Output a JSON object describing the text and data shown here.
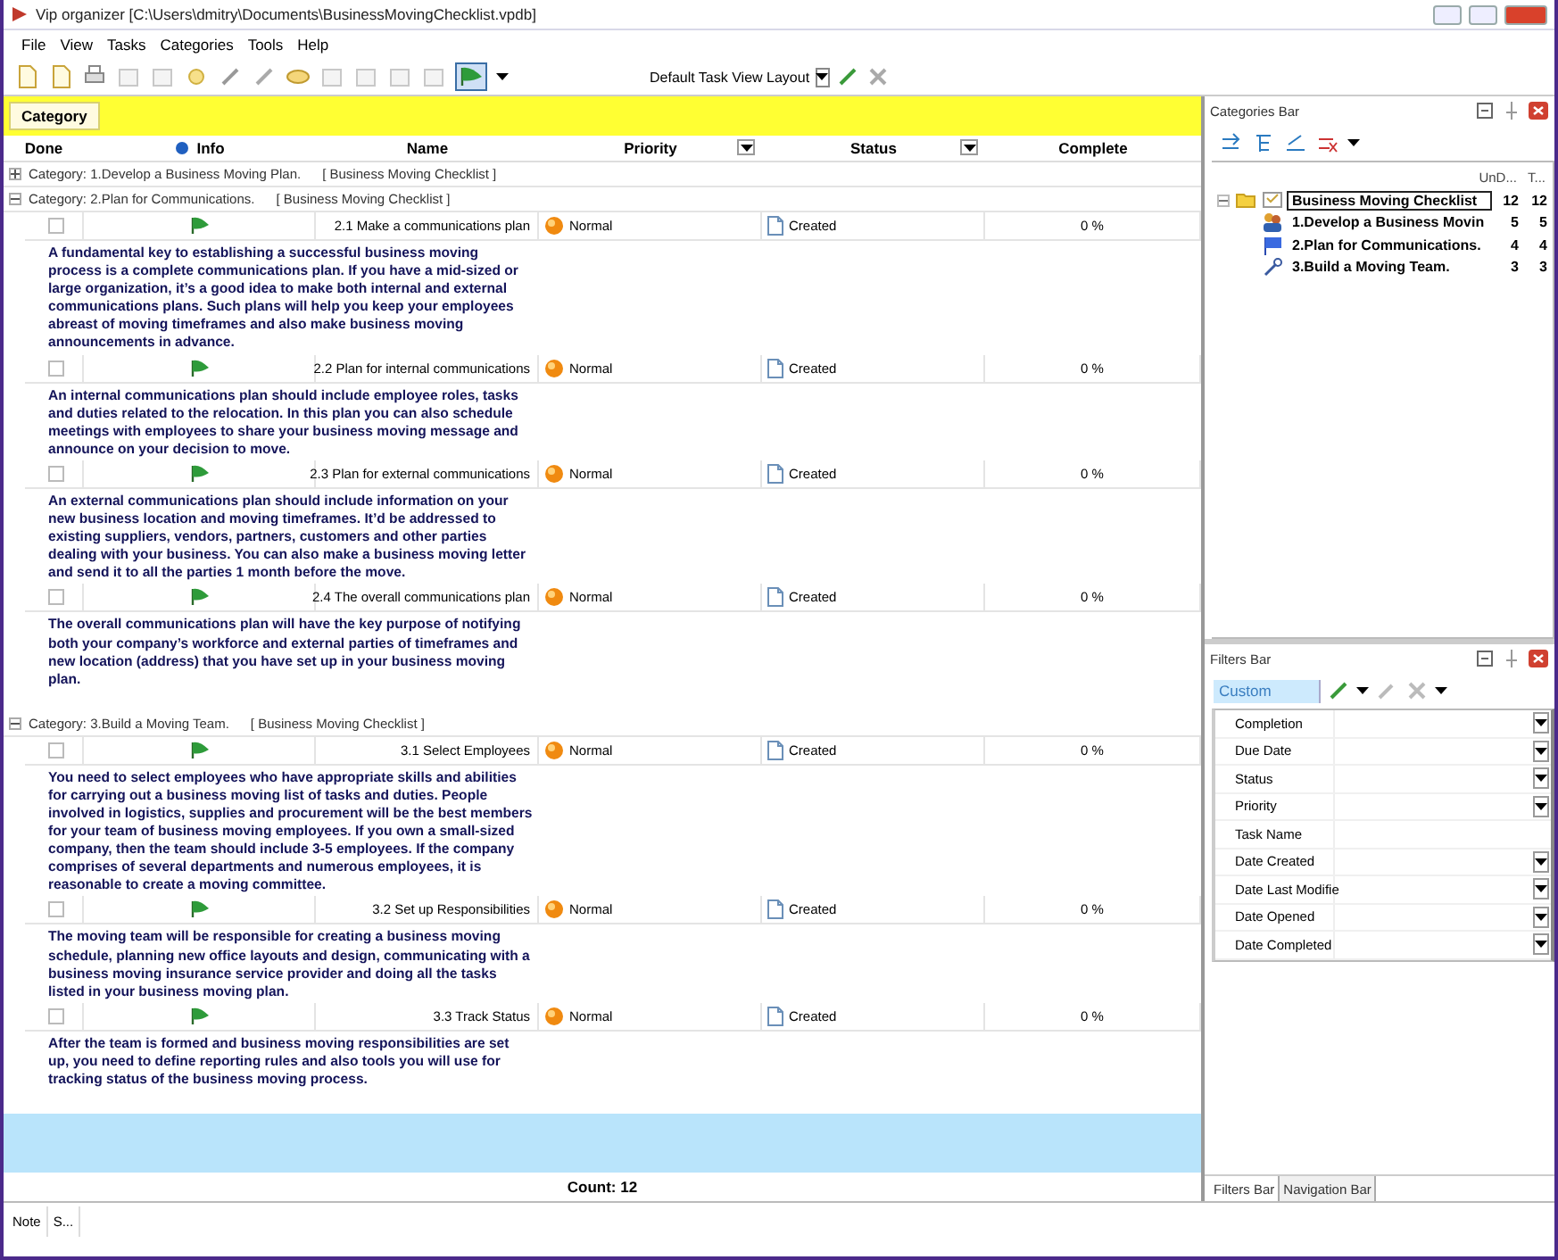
{
  "window": {
    "title": "Vip organizer [C:\\Users\\dmitry\\Documents\\BusinessMovingChecklist.vpdb]"
  },
  "menu": [
    "File",
    "View",
    "Tasks",
    "Categories",
    "Tools",
    "Help"
  ],
  "toolbar": {
    "layout": "Default Task View Layout"
  },
  "group_by": {
    "label": "Category"
  },
  "columns": [
    "Done",
    "Info",
    "Name",
    "Priority",
    "Status",
    "Complete"
  ],
  "groups": [
    {
      "label": "Category: 1.Develop a Business Moving Plan.",
      "checklist": "[ Business Moving Checklist ]",
      "expanded": false
    },
    {
      "label": "Category: 2.Plan for Communications.",
      "checklist": "[ Business Moving Checklist ]",
      "expanded": true,
      "tasks": [
        {
          "done": false,
          "name": "2.1 Make a communications plan",
          "priority": "Normal",
          "status": "Created",
          "complete": "0 %",
          "description": "A fundamental key to establishing a successful business moving process is a complete communications plan. If you have a mid-sized or large organization, it’s a good idea to make both internal and external communications plans. Such plans will help you keep your employees abreast of moving timeframes and also make business moving announcements in advance."
        },
        {
          "done": false,
          "name": "2.2 Plan for internal communications",
          "priority": "Normal",
          "status": "Created",
          "complete": "0 %",
          "description": "An internal communications plan should include employee roles, tasks and duties related to the relocation. In this plan you can also schedule meetings with employees to share your business moving message and announce on your decision to move."
        },
        {
          "done": false,
          "name": "2.3 Plan for external communications",
          "priority": "Normal",
          "status": "Created",
          "complete": "0 %",
          "description": "An external communications plan should include information on your new business location and moving timeframes. It’d be addressed to existing suppliers, vendors, partners, customers and other parties dealing with your business. You can also make a business moving letter and send it to all the parties 1 month before the move."
        },
        {
          "done": false,
          "name": "2.4 The overall communications plan",
          "priority": "Normal",
          "status": "Created",
          "complete": "0 %",
          "description": "The overall communications plan will have the key purpose of notifying both your company’s workforce and external parties of timeframes and new location (address) that you have set up in your business moving plan."
        }
      ]
    },
    {
      "label": "Category: 3.Build a Moving Team.",
      "checklist": "[ Business Moving Checklist ]",
      "expanded": true,
      "tasks": [
        {
          "done": false,
          "name": "3.1 Select Employees",
          "priority": "Normal",
          "status": "Created",
          "complete": "0 %",
          "description": "You need to select employees who have appropriate skills and abilities for carrying out a business moving list of tasks and duties. People involved in logistics, supplies and procurement will be the best members for your team of business moving employees. If you own a small-sized company, then the team should include 3-5 employees. If the company comprises of several departments and numerous employees, it is reasonable to create a moving committee."
        },
        {
          "done": false,
          "name": "3.2 Set up Responsibilities",
          "priority": "Normal",
          "status": "Created",
          "complete": "0 %",
          "description": "The moving team will be responsible for creating a business moving schedule, planning new office layouts and design, communicating with a business moving insurance service provider and doing all the tasks listed in your business moving plan."
        },
        {
          "done": false,
          "name": "3.3 Track Status",
          "priority": "Normal",
          "status": "Created",
          "complete": "0 %",
          "description": "After the team is formed and business moving responsibilities are set up, you need to define reporting rules and also tools you will use for tracking status of the business moving process."
        }
      ]
    }
  ],
  "count": "Count: 12",
  "status_bar": [
    "Note",
    "S..."
  ],
  "categories_bar": {
    "title": "Categories Bar",
    "columns": [
      "UnD...",
      "T..."
    ],
    "tree": [
      {
        "label": "Business Moving Checklist",
        "kind": "checklist",
        "undone": "12",
        "total": "12",
        "expanded": true,
        "selected": true,
        "children": [
          {
            "label": "1.Develop a Business Movin",
            "kind": "people",
            "undone": "5",
            "total": "5",
            "selected": false
          },
          {
            "label": "2.Plan for Communications.",
            "kind": "flag",
            "undone": "4",
            "total": "4",
            "selected": false
          },
          {
            "label": "3.Build a Moving Team.",
            "kind": "tool",
            "undone": "3",
            "total": "3",
            "selected": false
          }
        ]
      }
    ]
  },
  "filters_bar": {
    "title": "Filters Bar",
    "preset": "Custom",
    "fields": [
      {
        "label": "Completion",
        "dropdown": true
      },
      {
        "label": "Due Date",
        "dropdown": true
      },
      {
        "label": "Status",
        "dropdown": true
      },
      {
        "label": "Priority",
        "dropdown": true
      },
      {
        "label": "Task Name",
        "dropdown": false
      },
      {
        "label": "Date Created",
        "dropdown": true
      },
      {
        "label": "Date Last Modifie",
        "dropdown": true
      },
      {
        "label": "Date Opened",
        "dropdown": true
      },
      {
        "label": "Date Completed",
        "dropdown": true
      }
    ]
  },
  "bottom_tabs": [
    {
      "label": "Filters Bar",
      "selected": true
    },
    {
      "label": "Navigation Bar",
      "selected": false
    }
  ]
}
